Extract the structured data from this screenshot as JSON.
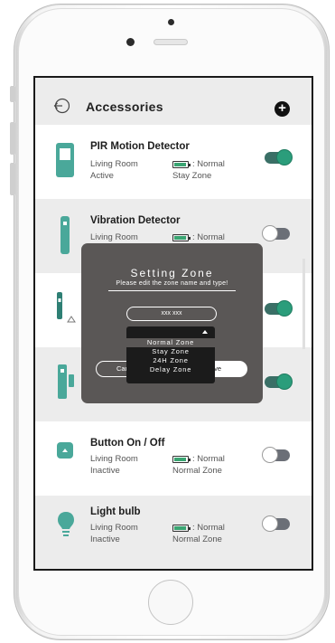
{
  "header": {
    "title": "Accessories",
    "back_icon": "back-arrow-icon",
    "add_icon": "add-circle-icon",
    "add_symbol": "+"
  },
  "accessories": [
    {
      "name": "PIR Motion Detector",
      "location": "Living Room",
      "state": "Active",
      "battery": ": Normal",
      "zone": "Stay Zone",
      "enabled": true,
      "icon": "motion-sensor-icon"
    },
    {
      "name": "Vibration Detector",
      "location": "Living Room",
      "state": "",
      "battery": ": Normal",
      "zone": "",
      "enabled": false,
      "icon": "vibration-sensor-icon"
    },
    {
      "name": "",
      "location": "",
      "state": "",
      "battery": "",
      "zone": "",
      "enabled": true,
      "icon": "door-sensor-icon"
    },
    {
      "name": "",
      "location": "",
      "state": "",
      "battery": "",
      "zone": "",
      "enabled": true,
      "icon": "contact-sensor-icon"
    },
    {
      "name": "Button On / Off",
      "location": "Living Room",
      "state": "Inactive",
      "battery": ": Normal",
      "zone": "Normal Zone",
      "enabled": false,
      "icon": "button-icon"
    },
    {
      "name": "Light bulb",
      "location": "Living Room",
      "state": "Inactive",
      "battery": ": Normal",
      "zone": "Normal Zone",
      "enabled": false,
      "icon": "light-bulb-icon"
    }
  ],
  "modal": {
    "title": "Setting Zone",
    "subtitle": "Please edit the zone name and type!",
    "zone_name_value": "xxx xxx",
    "cancel_label": "Cancel",
    "save_label": "Save",
    "zone_options": [
      "Normal Zone",
      "Stay Zone",
      "24H Zone",
      "Delay Zone"
    ],
    "selected_option": "Normal Zone"
  },
  "colors": {
    "accent": "#2b9d7b",
    "icon_teal": "#4aa89a",
    "overlay": "#5a5756",
    "row_gray": "#ececec"
  }
}
